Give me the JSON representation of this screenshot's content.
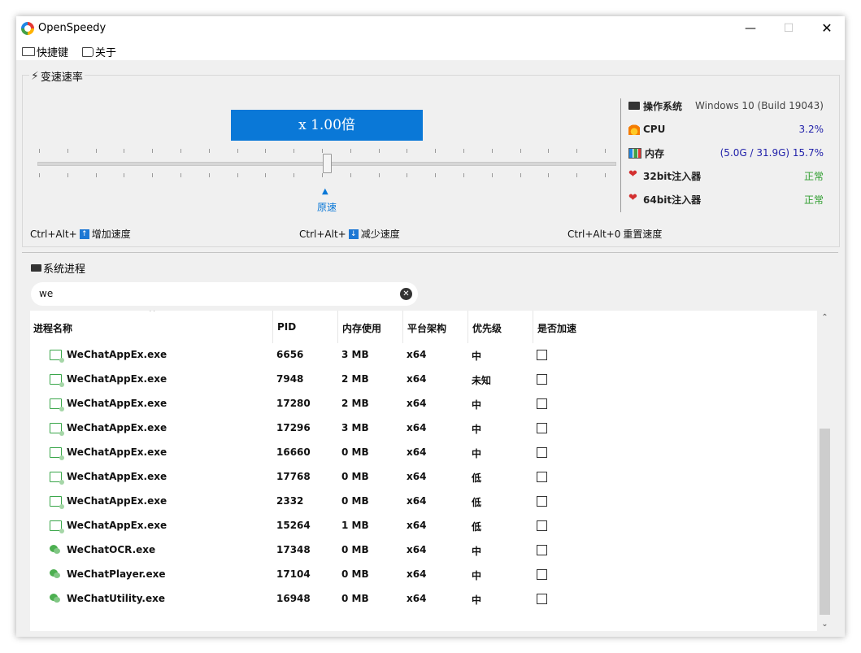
{
  "window": {
    "title": "OpenSpeedy",
    "minimize": "—",
    "maximize": "☐",
    "close": "✕"
  },
  "menu": {
    "hotkeys": "快捷键",
    "about": "关于"
  },
  "speed": {
    "group_title": "变速速率",
    "display": "x 1.00倍",
    "slider_value": 1.0,
    "origin_label": "原速",
    "shortcuts": [
      {
        "prefix": "Ctrl+Alt+",
        "key": "↑",
        "label": "增加速度"
      },
      {
        "prefix": "Ctrl+Alt+",
        "key": "↓",
        "label": "减少速度"
      },
      {
        "prefix": "Ctrl+Alt+0",
        "key": "",
        "label": "重置速度"
      }
    ]
  },
  "system_info": [
    {
      "icon": "monitor-icon",
      "label": "操作系统",
      "value": "Windows 10 (Build 19043)",
      "color": "#444444"
    },
    {
      "icon": "fire-icon",
      "label": "CPU",
      "value": "3.2%",
      "color": "#2222aa"
    },
    {
      "icon": "chart-icon",
      "label": "内存",
      "value": "(5.0G / 31.9G) 15.7%",
      "color": "#2222aa"
    },
    {
      "icon": "heart-icon",
      "label": "32bit注入器",
      "value": "正常",
      "color": "#2e9d2e"
    },
    {
      "icon": "heart-icon",
      "label": "64bit注入器",
      "value": "正常",
      "color": "#2e9d2e"
    }
  ],
  "process": {
    "group_title": "系统进程",
    "search_value": "we",
    "columns": [
      "进程名称",
      "PID",
      "内存使用",
      "平台架构",
      "优先级",
      "是否加速"
    ],
    "rows": [
      {
        "icon": "app-window-icon",
        "name": "WeChatAppEx.exe",
        "pid": "6656",
        "mem": "3 MB",
        "arch": "x64",
        "priority": "中",
        "accelerated": false
      },
      {
        "icon": "app-window-icon",
        "name": "WeChatAppEx.exe",
        "pid": "7948",
        "mem": "2 MB",
        "arch": "x64",
        "priority": "未知",
        "accelerated": false
      },
      {
        "icon": "app-window-icon",
        "name": "WeChatAppEx.exe",
        "pid": "17280",
        "mem": "2 MB",
        "arch": "x64",
        "priority": "中",
        "accelerated": false
      },
      {
        "icon": "app-window-icon",
        "name": "WeChatAppEx.exe",
        "pid": "17296",
        "mem": "3 MB",
        "arch": "x64",
        "priority": "中",
        "accelerated": false
      },
      {
        "icon": "app-window-icon",
        "name": "WeChatAppEx.exe",
        "pid": "16660",
        "mem": "0 MB",
        "arch": "x64",
        "priority": "中",
        "accelerated": false
      },
      {
        "icon": "app-window-icon",
        "name": "WeChatAppEx.exe",
        "pid": "17768",
        "mem": "0 MB",
        "arch": "x64",
        "priority": "低",
        "accelerated": false
      },
      {
        "icon": "app-window-icon",
        "name": "WeChatAppEx.exe",
        "pid": "2332",
        "mem": "0 MB",
        "arch": "x64",
        "priority": "低",
        "accelerated": false
      },
      {
        "icon": "app-window-icon",
        "name": "WeChatAppEx.exe",
        "pid": "15264",
        "mem": "1 MB",
        "arch": "x64",
        "priority": "低",
        "accelerated": false
      },
      {
        "icon": "wechat-icon",
        "name": "WeChatOCR.exe",
        "pid": "17348",
        "mem": "0 MB",
        "arch": "x64",
        "priority": "中",
        "accelerated": false
      },
      {
        "icon": "wechat-icon",
        "name": "WeChatPlayer.exe",
        "pid": "17104",
        "mem": "0 MB",
        "arch": "x64",
        "priority": "中",
        "accelerated": false
      },
      {
        "icon": "wechat-icon",
        "name": "WeChatUtility.exe",
        "pid": "16948",
        "mem": "0 MB",
        "arch": "x64",
        "priority": "中",
        "accelerated": false
      }
    ]
  }
}
